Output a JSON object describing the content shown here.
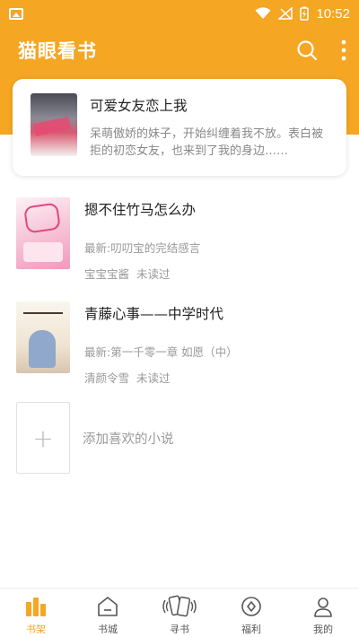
{
  "status_bar": {
    "time": "10:52"
  },
  "app_bar": {
    "title": "猫眼看书"
  },
  "featured": {
    "title": "可爱女友恋上我",
    "description": "呆萌傲娇的妹子，开始纠缠着我不放。表白被拒的初恋女友，也来到了我的身边……"
  },
  "books": [
    {
      "title": "摁不住竹马怎么办",
      "latest": "最新:叨叨宝的完结感言",
      "author": "宝宝宝酱",
      "status": "未读过"
    },
    {
      "title": "青藤心事——中学时代",
      "latest": "最新:第一千零一章 如愿（中）",
      "author": "清颜令雪",
      "status": "未读过"
    }
  ],
  "add_book": {
    "icon": "+",
    "label": "添加喜欢的小说"
  },
  "nav": [
    {
      "label": "书架",
      "icon": "bookshelf-icon",
      "active": true
    },
    {
      "label": "书城",
      "icon": "bookstore-icon",
      "active": false
    },
    {
      "label": "寻书",
      "icon": "shake-cards-icon",
      "active": false
    },
    {
      "label": "福利",
      "icon": "gift-diamond-icon",
      "active": false
    },
    {
      "label": "我的",
      "icon": "profile-icon",
      "active": false
    }
  ],
  "colors": {
    "accent": "#f5a623",
    "muted_text": "#999999"
  }
}
